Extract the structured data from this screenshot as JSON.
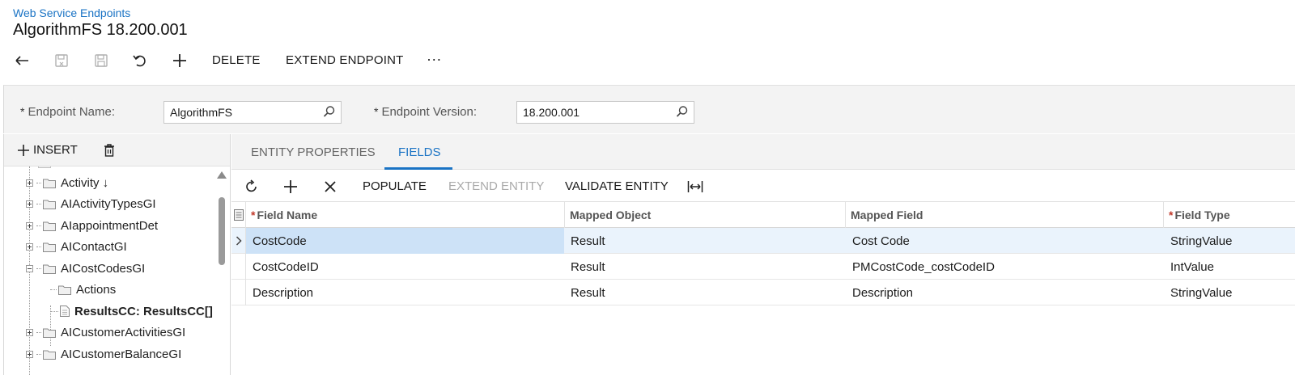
{
  "breadcrumb": "Web Service Endpoints",
  "title": "AlgorithmFS 18.200.001",
  "toolbar": {
    "back_icon": "back-arrow-icon",
    "save_close_icon": "save-close-icon",
    "save_icon": "save-icon",
    "undo_icon": "undo-icon",
    "add_icon": "plus-icon",
    "delete_label": "DELETE",
    "extend_endpoint_label": "EXTEND ENDPOINT",
    "more_label": "···"
  },
  "form": {
    "endpoint_name_label": "Endpoint Name:",
    "endpoint_name_value": "AlgorithmFS",
    "endpoint_version_label": "Endpoint Version:",
    "endpoint_version_value": "18.200.001",
    "required_mark": "*"
  },
  "left_toolbar": {
    "insert_label": "INSERT"
  },
  "tree": {
    "items": [
      {
        "label": "Activity ↓"
      },
      {
        "label": "AIActivityTypesGI"
      },
      {
        "label": "AIappointmentDet"
      },
      {
        "label": "AIContactGI"
      },
      {
        "label": "AICostCodesGI"
      },
      {
        "label": "Actions"
      },
      {
        "label": "ResultsCC: ResultsCC[]"
      },
      {
        "label": "AICustomerActivitiesGI"
      },
      {
        "label": "AICustomerBalanceGI"
      }
    ]
  },
  "tabs": [
    {
      "label": "ENTITY PROPERTIES"
    },
    {
      "label": "FIELDS"
    }
  ],
  "grid_toolbar": {
    "refresh_icon": "refresh-icon",
    "add_icon": "plus-icon",
    "delete_icon": "close-icon",
    "populate_label": "POPULATE",
    "extend_entity_label": "EXTEND ENTITY",
    "validate_entity_label": "VALIDATE ENTITY",
    "fit_icon": "fit-columns-icon"
  },
  "grid": {
    "columns": [
      "Field Name",
      "Mapped Object",
      "Mapped Field",
      "Field Type"
    ],
    "required_mark": "*",
    "rows": [
      {
        "field_name": "CostCode",
        "mapped_object": "Result",
        "mapped_field": "Cost Code",
        "field_type": "StringValue"
      },
      {
        "field_name": "CostCodeID",
        "mapped_object": "Result",
        "mapped_field": "PMCostCode_costCodeID",
        "field_type": "IntValue"
      },
      {
        "field_name": "Description",
        "mapped_object": "Result",
        "mapped_field": "Description",
        "field_type": "StringValue"
      }
    ]
  },
  "colors": {
    "accent": "#1a73c4",
    "selected_row": "#eaf3fc",
    "active_cell": "#cde2f7",
    "required_red": "#c0392b"
  }
}
